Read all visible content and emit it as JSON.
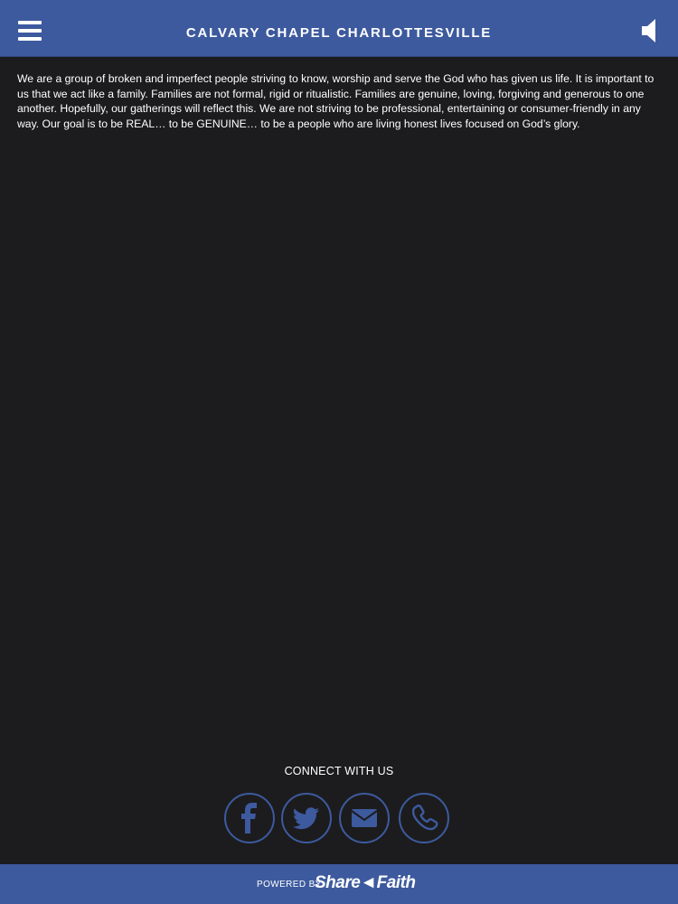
{
  "header": {
    "title": "CALVARY CHAPEL CHARLOTTESVILLE",
    "menu_icon": "hamburger-menu-icon",
    "audio_icon": "speaker-icon"
  },
  "main": {
    "body_text": "We are a group of broken and imperfect people striving to know, worship and serve the God who has given us life. It is important to us that we act like a family. Families are not formal, rigid or ritualistic. Families are genuine, loving, forgiving and generous to one another. Hopefully, our gatherings will reflect this. We are not striving to be professional, entertaining or consumer-friendly in any way. Our goal is to be REAL… to be GENUINE… to be a people who are living honest lives focused on God’s glory."
  },
  "connect": {
    "heading": "CONNECT WITH US",
    "links": [
      {
        "icon": "facebook-icon"
      },
      {
        "icon": "twitter-icon"
      },
      {
        "icon": "email-icon"
      },
      {
        "icon": "phone-icon"
      }
    ]
  },
  "footer": {
    "powered_by": "POWERED BY",
    "brand": "Share◄Faith"
  },
  "colors": {
    "header_bg": "#3d5a9e",
    "page_bg": "#1c1c1e",
    "text": "#ffffff"
  }
}
